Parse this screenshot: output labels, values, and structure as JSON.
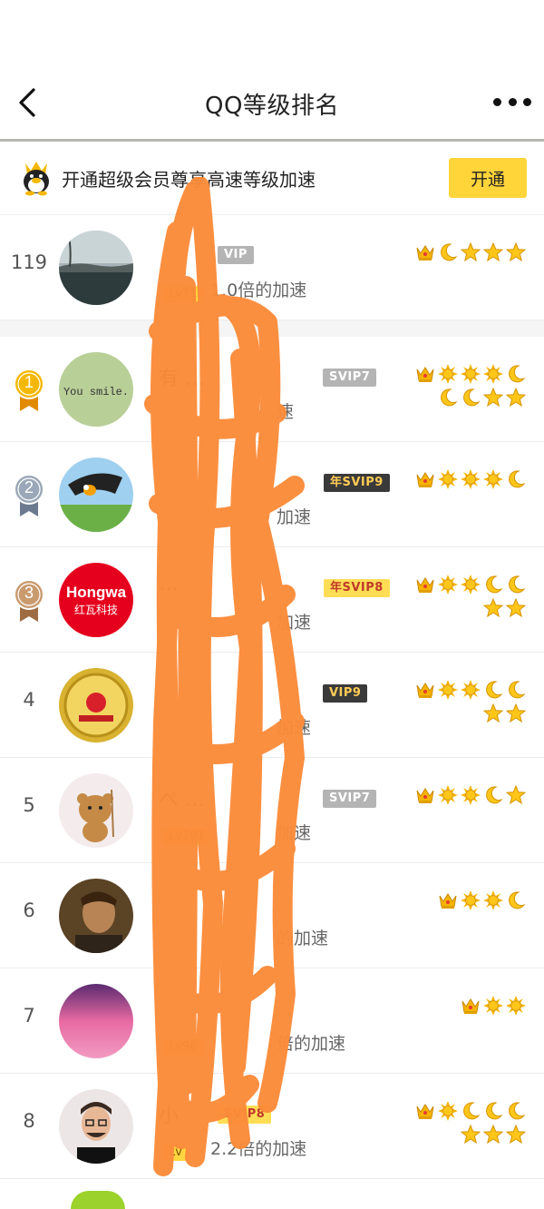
{
  "nav": {
    "title": "QQ等级排名"
  },
  "banner": {
    "text": "开通超级会员尊享高速等级加速",
    "button": "开通"
  },
  "self": {
    "rank": "119",
    "badge": "VIP",
    "level": "Lv71",
    "speed": "1.0倍的加速",
    "icons": [
      "crown",
      "moon",
      "star",
      "star",
      "star"
    ]
  },
  "ranking": [
    {
      "rank": "1",
      "medal": true,
      "name": "有",
      "name_suffix": "…",
      "badge": "SVIP7",
      "badge_style": "gray",
      "speed": "速",
      "icons": [
        "crown",
        "sun",
        "sun",
        "sun",
        "moon",
        "moon",
        "moon",
        "star",
        "star"
      ]
    },
    {
      "rank": "2",
      "medal": true,
      "name": "",
      "badge": "年SVIP9",
      "badge_style": "dark",
      "speed": "加速",
      "icons": [
        "crown",
        "sun",
        "sun",
        "sun",
        "moon"
      ]
    },
    {
      "rank": "3",
      "medal": true,
      "name": "…",
      "badge": "年SVIP8",
      "badge_style": "gold",
      "speed": "加速",
      "avatar_text": "Hongwa",
      "avatar_sub": "红瓦科技",
      "icons": [
        "crown",
        "sun",
        "sun",
        "moon",
        "moon",
        "star",
        "star"
      ]
    },
    {
      "rank": "4",
      "medal": false,
      "name": "",
      "badge": "VIP9",
      "badge_style": "dark",
      "speed": "加速",
      "icons": [
        "crown",
        "sun",
        "sun",
        "moon",
        "moon",
        "star",
        "star"
      ]
    },
    {
      "rank": "5",
      "medal": false,
      "name": "ぺ",
      "name_suffix": "…",
      "badge": "SVIP7",
      "badge_style": "gray",
      "level": "Lv101",
      "speed": "加速",
      "icons": [
        "crown",
        "sun",
        "sun",
        "moon",
        "star"
      ]
    },
    {
      "rank": "6",
      "medal": false,
      "name": "",
      "badge": "",
      "badge_style": "gray",
      "speed": "的加速",
      "icons": [
        "crown",
        "sun",
        "sun",
        "moon"
      ]
    },
    {
      "rank": "7",
      "medal": false,
      "name": "",
      "badge": "",
      "badge_style": "gray",
      "level": "Lv96",
      "speed": "倍的加速",
      "icons": [
        "crown",
        "sun",
        "sun"
      ]
    },
    {
      "rank": "8",
      "medal": false,
      "name": "小",
      "badge": "SVIP8",
      "badge_style": "gold",
      "level": "Lv",
      "speed": "2.2倍的加速",
      "icons": [
        "crown",
        "sun",
        "moon",
        "moon",
        "moon",
        "star",
        "star",
        "star"
      ]
    }
  ],
  "avatar_1_text": "You smile.",
  "colors": {
    "accent": "#ffd53a",
    "gold": "#f0b400",
    "scribble": "#fb8c3a"
  }
}
